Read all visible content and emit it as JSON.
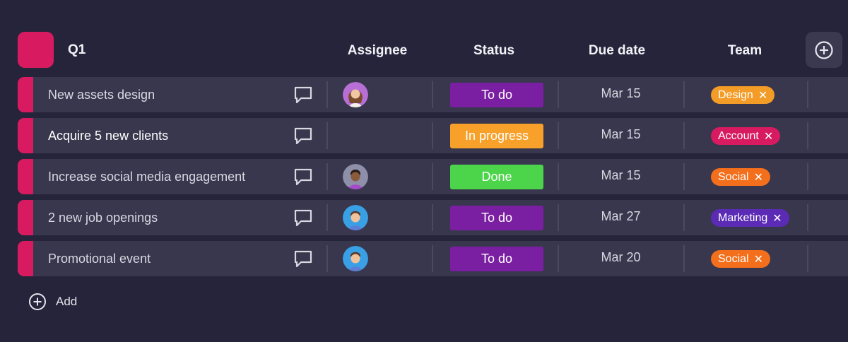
{
  "group": {
    "title": "Q1",
    "color": "#d81b60"
  },
  "columns": {
    "assignee": "Assignee",
    "status": "Status",
    "due_date": "Due date",
    "team": "Team"
  },
  "rows": [
    {
      "name": "New assets design",
      "assignee_avatar": "avatar-woman-icon",
      "status": "To do",
      "status_color": "#7b1fa2",
      "due": "Mar 15",
      "team": "Design",
      "team_color": "#f39c27"
    },
    {
      "name": "Acquire 5 new clients",
      "assignee_avatar": "",
      "status": "In progress",
      "status_color": "#f7a12b",
      "due": "Mar 15",
      "team": "Account",
      "team_color": "#d81b60"
    },
    {
      "name": "Increase social media engagement",
      "assignee_avatar": "avatar-man-dark-icon",
      "status": "Done",
      "status_color": "#4cd54a",
      "due": "Mar 15",
      "team": "Social",
      "team_color": "#f36f1c"
    },
    {
      "name": "2 new job openings",
      "assignee_avatar": "avatar-man-blue-icon",
      "status": "To do",
      "status_color": "#7b1fa2",
      "due": "Mar 27",
      "team": "Marketing",
      "team_color": "#5b2bb5"
    },
    {
      "name": "Promotional event",
      "assignee_avatar": "avatar-man-blue-icon",
      "status": "To do",
      "status_color": "#7b1fa2",
      "due": "Mar 20",
      "team": "Social",
      "team_color": "#f36f1c"
    }
  ],
  "add": {
    "label": "Add"
  },
  "tag_remove_glyph": "✕"
}
